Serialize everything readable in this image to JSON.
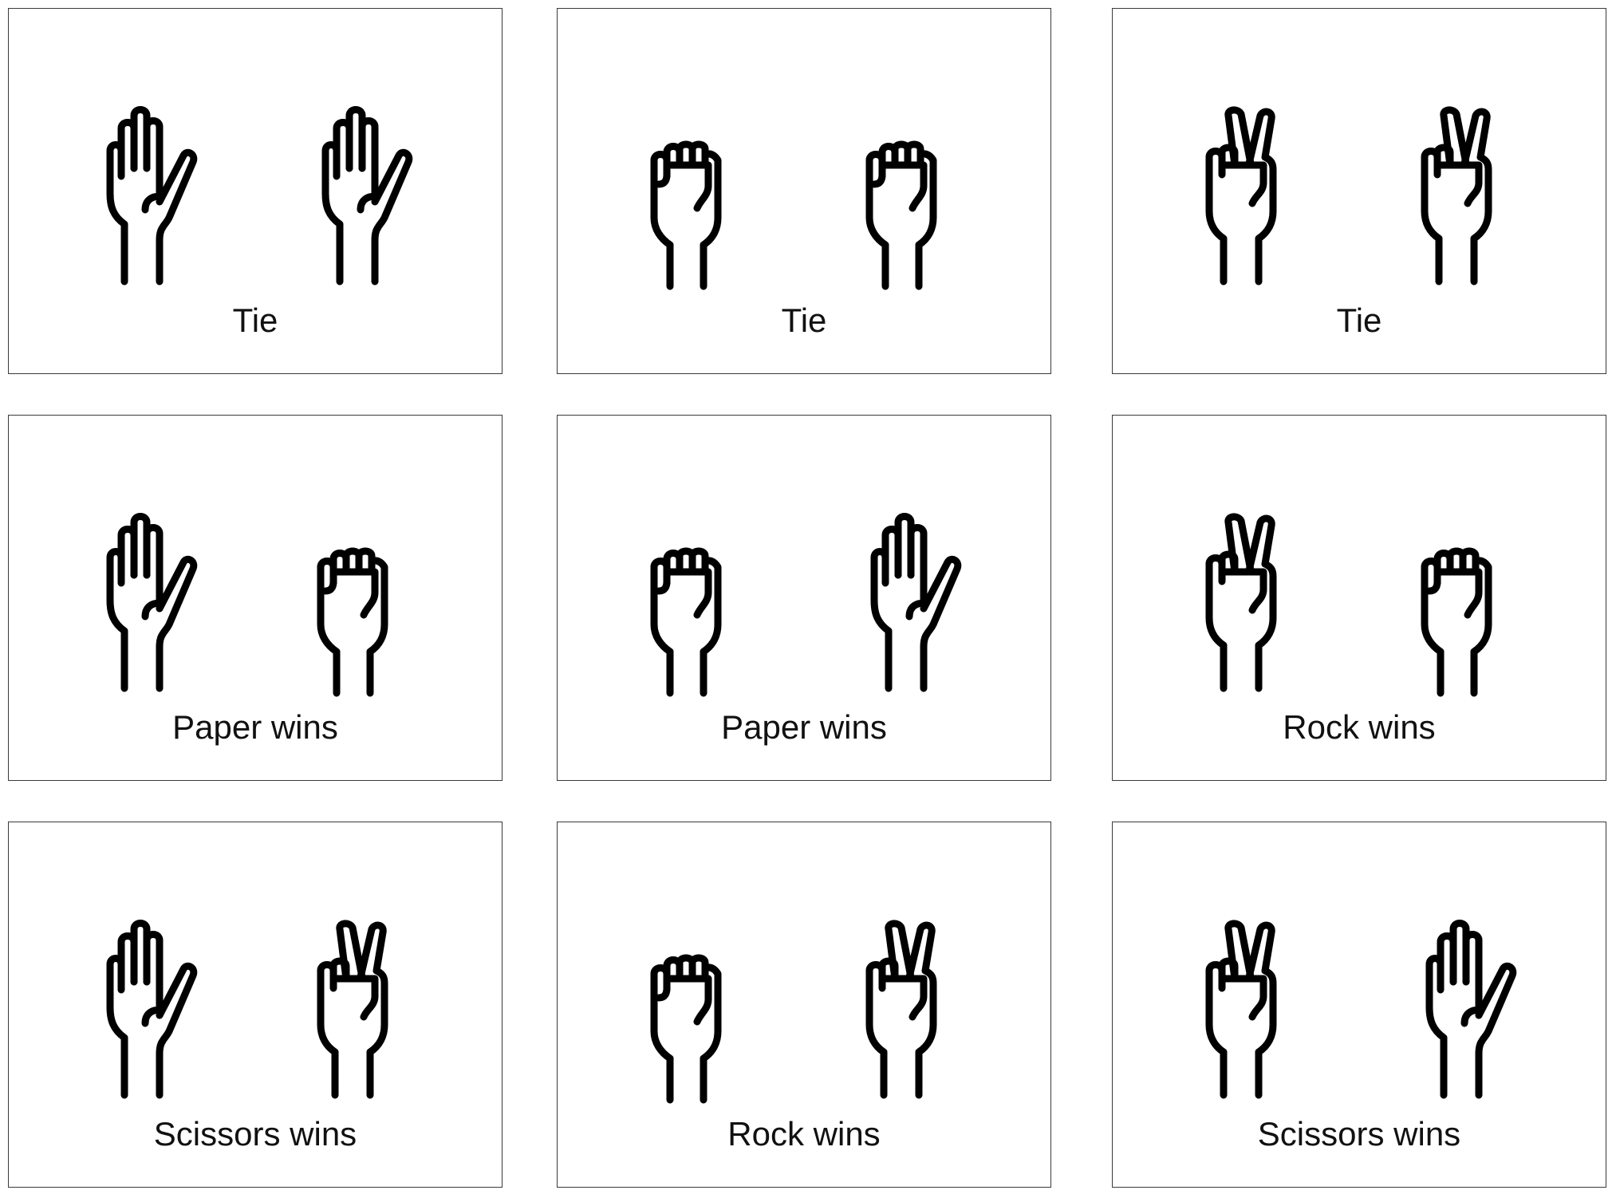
{
  "colors": {
    "stroke": "#000000",
    "border": "#3a3a3a",
    "background": "#ffffff"
  },
  "cards": [
    {
      "left": "paper",
      "right": "paper",
      "result": "Tie"
    },
    {
      "left": "rock",
      "right": "rock",
      "result": "Tie"
    },
    {
      "left": "scissors",
      "right": "scissors",
      "result": "Tie"
    },
    {
      "left": "paper",
      "right": "rock",
      "result": "Paper wins"
    },
    {
      "left": "rock",
      "right": "paper",
      "result": "Paper wins"
    },
    {
      "left": "scissors",
      "right": "rock",
      "result": "Rock wins"
    },
    {
      "left": "paper",
      "right": "scissors",
      "result": "Scissors wins"
    },
    {
      "left": "rock",
      "right": "scissors",
      "result": "Rock wins"
    },
    {
      "left": "scissors",
      "right": "paper",
      "result": "Scissors wins"
    }
  ]
}
